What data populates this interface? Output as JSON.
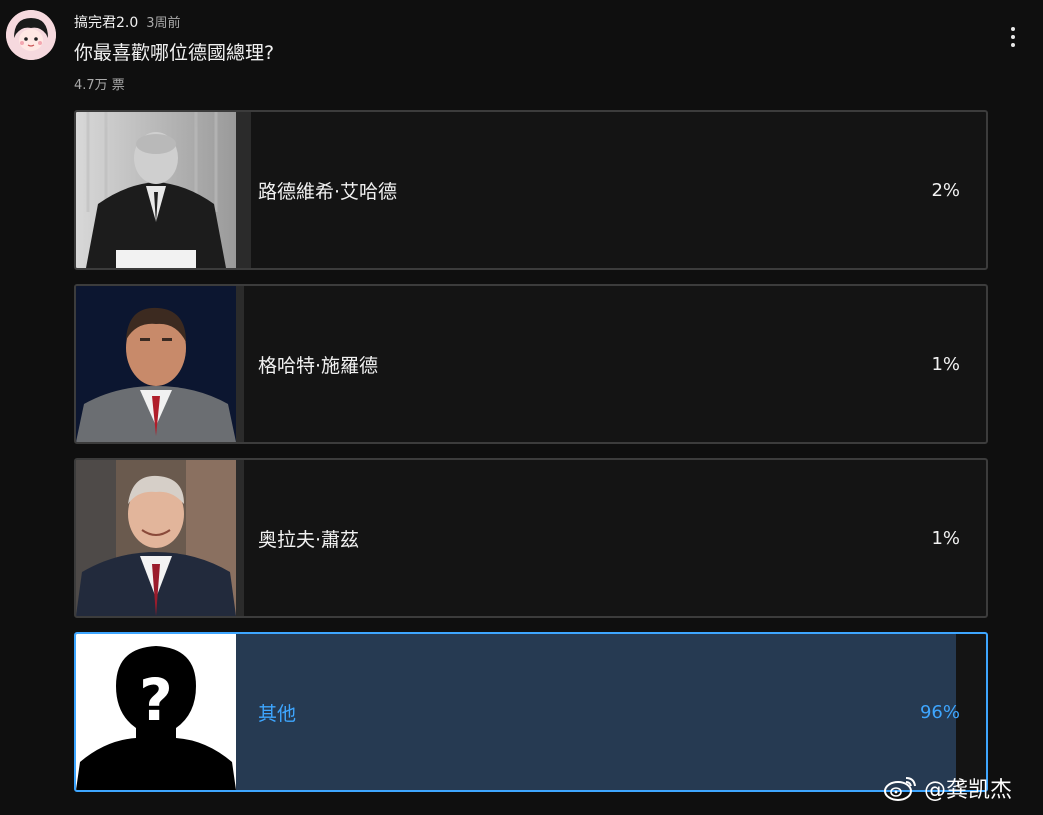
{
  "post": {
    "author": "搞完君2.0",
    "time": "3周前",
    "question": "你最喜歡哪位德國總理?",
    "votes": "4.7万 票"
  },
  "options": [
    {
      "label": "路德維希·艾哈德",
      "percent_text": "2%",
      "percent": 2,
      "selected": false
    },
    {
      "label": "格哈特·施羅德",
      "percent_text": "1%",
      "percent": 1,
      "selected": false
    },
    {
      "label": "奥拉夫·蕭茲",
      "percent_text": "1%",
      "percent": 1,
      "selected": false
    },
    {
      "label": "其他",
      "percent_text": "96%",
      "percent": 96,
      "selected": true
    }
  ],
  "watermark": {
    "icon": "weibo-icon",
    "text": "@龚凯杰"
  },
  "colors": {
    "background": "#0f0f0f",
    "accent": "#3ea6ff",
    "selected_fill": "#263a52",
    "option_border": "#3c3c3c"
  },
  "icons": {
    "more": "more-vertical-icon",
    "avatar": "avatar-icon"
  }
}
